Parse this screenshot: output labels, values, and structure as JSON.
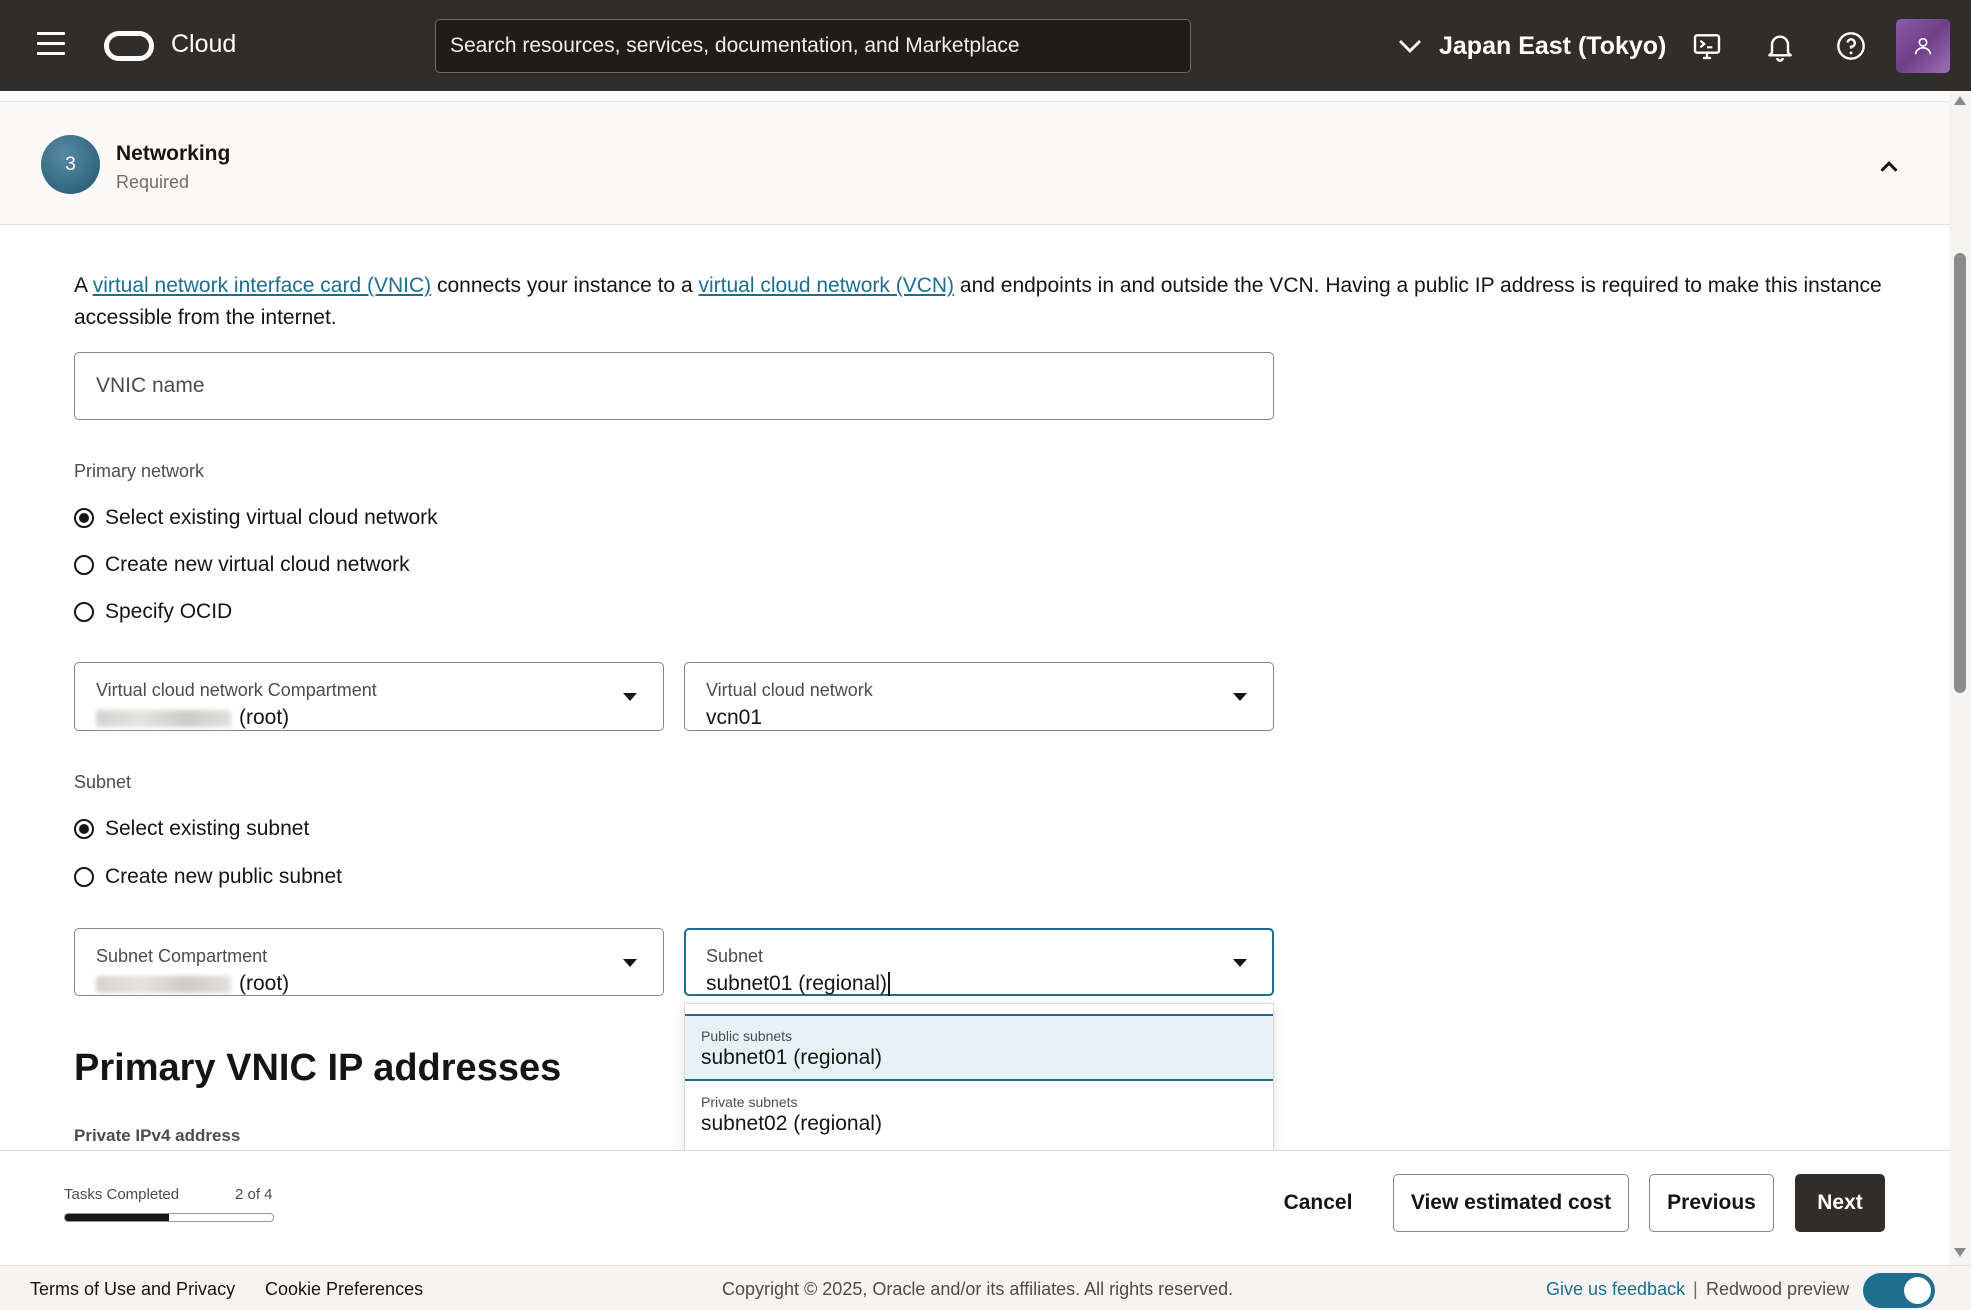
{
  "topbar": {
    "brand": "Cloud",
    "search_placeholder": "Search resources, services, documentation, and Marketplace",
    "region": "Japan East (Tokyo)",
    "icons": [
      "menu-icon",
      "cloud-logo-icon",
      "chevron-down-icon",
      "cloud-shell-icon",
      "bell-icon",
      "help-icon",
      "user-icon"
    ]
  },
  "section": {
    "step": "3",
    "title": "Networking",
    "subtitle": "Required"
  },
  "intro": {
    "t1": "A ",
    "link1": "virtual network interface card (VNIC)",
    "t2": " connects your instance to a ",
    "link2": "virtual cloud network (VCN)",
    "t3": " and endpoints in and outside the VCN. Having a public IP address is required to make this instance accessible from the internet."
  },
  "vnic_name": {
    "placeholder": "VNIC name",
    "value": ""
  },
  "primary_network": {
    "label": "Primary network",
    "options": [
      {
        "label": "Select existing virtual cloud network",
        "selected": true
      },
      {
        "label": "Create new virtual cloud network",
        "selected": false
      },
      {
        "label": "Specify OCID",
        "selected": false
      }
    ],
    "compartment": {
      "label": "Virtual cloud network Compartment",
      "value_suffix": "(root)"
    },
    "vcn": {
      "label": "Virtual cloud network",
      "value": "vcn01"
    }
  },
  "subnet": {
    "label": "Subnet",
    "options": [
      {
        "label": "Select existing subnet",
        "selected": true
      },
      {
        "label": "Create new public subnet",
        "selected": false
      }
    ],
    "compartment": {
      "label": "Subnet Compartment",
      "value_suffix": "(root)"
    },
    "subnet_field": {
      "label": "Subnet",
      "value": "subnet01 (regional)"
    },
    "dropdown": [
      {
        "group": "Public subnets",
        "option": "subnet01 (regional)",
        "highlighted": true
      },
      {
        "group": "Private subnets",
        "option": "subnet02 (regional)",
        "highlighted": false
      }
    ]
  },
  "ip_section": {
    "heading": "Primary VNIC IP addresses",
    "sub_label": "Private IPv4 address"
  },
  "actionbar": {
    "tasks_label": "Tasks Completed",
    "tasks_count": "2 of 4",
    "progress_fraction": 0.5,
    "cancel": "Cancel",
    "estimate": "View estimated cost",
    "previous": "Previous",
    "next": "Next"
  },
  "footer": {
    "terms": "Terms of Use and Privacy",
    "cookies": "Cookie Preferences",
    "copyright": "Copyright © 2025, Oracle and/or its affiliates. All rights reserved.",
    "feedback": "Give us feedback",
    "separator": "|",
    "redwood": "Redwood preview",
    "redwood_enabled": true
  },
  "colors": {
    "topbar": "#312d2a",
    "link": "#1f6d8f",
    "badge": "#31667f",
    "primary_button": "#312d2a"
  }
}
